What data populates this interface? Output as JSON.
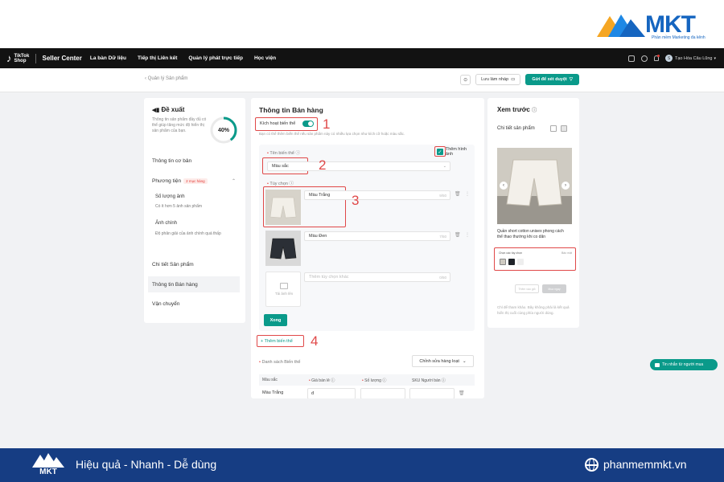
{
  "brand": {
    "name": "MKT",
    "subtitle": "Phần mềm Marketing đa kênh"
  },
  "topnav": {
    "logo": "TikTok Shop",
    "seller_center": "Seller Center",
    "items": [
      "La bàn Dữ liệu",
      "Tiếp thị Liên kết",
      "Quản lý phát trực tiếp",
      "Học viện"
    ],
    "user_initial": "S",
    "user_name": "Tạo Hóa Câu Lũng"
  },
  "subheader": {
    "breadcrumb": "‹ Quản lý Sản phẩm",
    "help": "⊙",
    "draft": "Lưu làm nháp",
    "submit": "Gửi để xét duyệt"
  },
  "left": {
    "title": "Đề xuất",
    "desc": "Thông tin sản phẩm đầy đủ có thể giúp tăng mức độ hiển thị sản phẩm của bạn.",
    "progress_label": "40%",
    "progress_value": 0.4,
    "items": {
      "basic": "Thông tin cơ bản",
      "media": "Phương tiện",
      "media_badge": "2 mục hàng",
      "image_count": "Số lượng ảnh",
      "image_count_desc": "Có ít hơn 5 ảnh sản phẩm",
      "image_main": "Ảnh chính",
      "image_main_desc": "Độ phân giải của ảnh chính quá thấp",
      "details": "Chi tiết Sản phẩm",
      "sales": "Thông tin Bán hàng",
      "shipping": "Vận chuyển"
    }
  },
  "center": {
    "title": "Thông tin Bán hàng",
    "toggle_label": "Kích hoạt biến thể",
    "toggle_desc": "Bạn có thể thêm biến thể nếu sản phẩm này có nhiều lựa chọn như kích cỡ hoặc màu sắc.",
    "variant_name_label": "Tên biến thể",
    "add_image_label": "Thêm hình ảnh",
    "variant_name_value": "Màu sắc",
    "options_label": "Tùy chọn",
    "options": [
      {
        "value": "Màu Trắng",
        "count": "9/50"
      },
      {
        "value": "Màu Đen",
        "count": "7/50"
      },
      {
        "value": "Thêm tùy chọn khác",
        "count": "0/50"
      }
    ],
    "upload_text": "Tải ảnh lên",
    "done": "Xong",
    "add_variant": "+ Thêm biến thể",
    "list_title": "Danh sách Biến thể",
    "batch_edit": "Chỉnh sửa hàng loạt",
    "table_headers": [
      "Màu sắc",
      "Giá bán lẻ",
      "Số lượng",
      "SKU Người bán"
    ],
    "table_rows": [
      {
        "color": "Màu Trắng",
        "price_prefix": "đ"
      }
    ],
    "numbers": [
      "1",
      "2",
      "3",
      "4"
    ]
  },
  "preview": {
    "title": "Xem trước",
    "subtitle": "Chi tiết sản phẩm",
    "product_desc": "Quần short cotton unisex phong cách thể thao thường khi co dãn",
    "variant_label": "Chọn các tùy chọn",
    "variant_more": "Bảo mật",
    "btn_cart": "Thêm vào giỏ",
    "btn_buy": "Mua ngay",
    "note": "Chỉ để tham khảo. Bây không phải là kết quả hiển thị cuối cùng phía người dùng."
  },
  "chat": {
    "label": "Tin nhắn từ người mua"
  },
  "footer": {
    "logo": "MKT",
    "tagline": "Hiệu quả - Nhanh - Dễ dùng",
    "website": "phanmemmkt.vn"
  },
  "colors": {
    "accent": "#0a9a8a",
    "highlight": "#e04848",
    "brand_blue": "#163d83",
    "topbar": "#121212"
  }
}
